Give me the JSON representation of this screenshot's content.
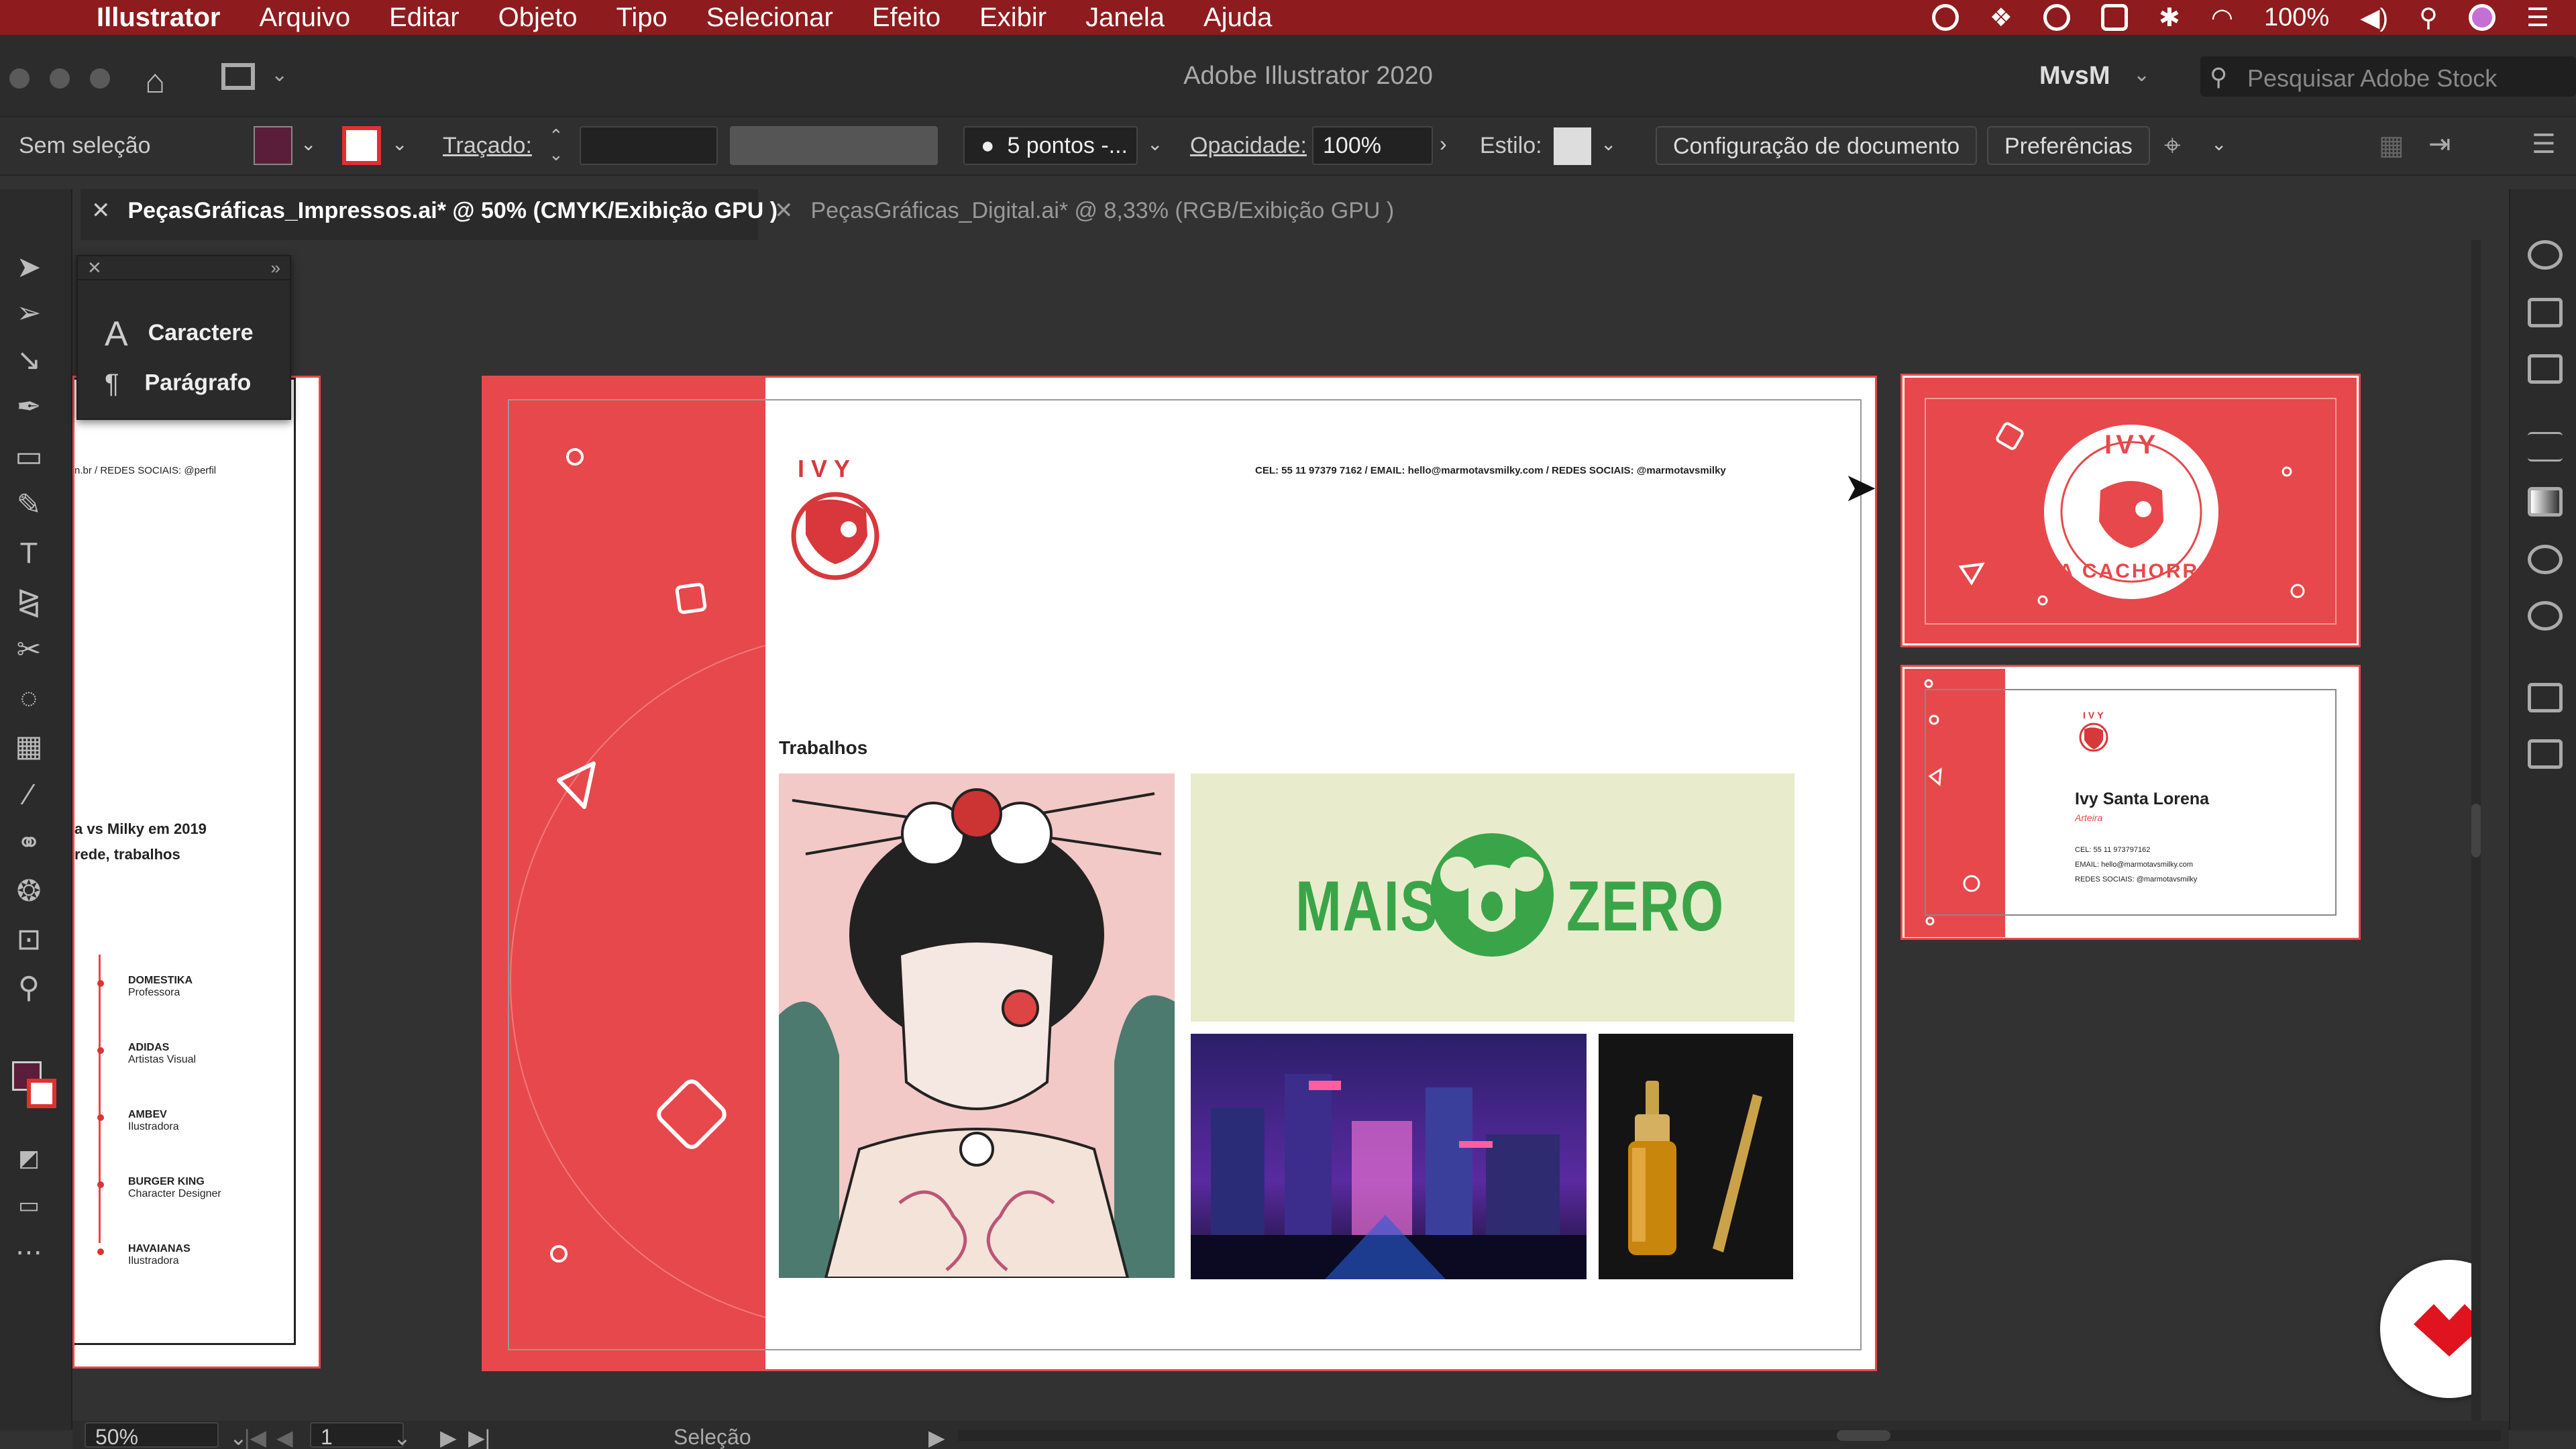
{
  "menubar": {
    "apple": "",
    "app_name": "Illustrator",
    "items": [
      "Arquivo",
      "Editar",
      "Objeto",
      "Tipo",
      "Selecionar",
      "Efeito",
      "Exibir",
      "Janela",
      "Ajuda"
    ],
    "battery": "100%"
  },
  "titlebar": {
    "title": "Adobe Illustrator 2020",
    "workspace": "MvsM",
    "search_placeholder": "Pesquisar Adobe Stock"
  },
  "control": {
    "selection": "Sem seleção",
    "stroke_label": "Traçado:",
    "brush": "5 pontos -...",
    "opacity_label": "Opacidade:",
    "opacity_value": "100%",
    "style_label": "Estilo:",
    "doc_setup": "Configuração de documento",
    "preferences": "Preferências",
    "fill_color": "#5a1e3a"
  },
  "tabs": [
    {
      "label": "PeçasGráficas_Impressos.ai* @ 50% (CMYK/Exibição GPU )",
      "active": true
    },
    {
      "label": "PeçasGráficas_Digital.ai* @ 8,33% (RGB/Exibição GPU )",
      "active": false
    }
  ],
  "char_panel": {
    "items": [
      "Caractere",
      "Parágrafo"
    ]
  },
  "cv_left": {
    "contact": "n.br / REDES SOCIAIS: @perfil",
    "line1": "a vs Milky em 2019",
    "line2": "rede, trabalhos",
    "items": [
      {
        "company": "DOMESTIKA",
        "role": "Professora"
      },
      {
        "company": "ADIDAS",
        "role": "Artistas Visual"
      },
      {
        "company": "AMBEV",
        "role": "Ilustradora"
      },
      {
        "company": "BURGER KING",
        "role": "Character Designer"
      },
      {
        "company": "HAVAIANAS",
        "role": "Ilustradora"
      }
    ]
  },
  "portfolio": {
    "logo_text": "IVY",
    "contact": "CEL: 55 11 97379 7162 / EMAIL: hello@marmotavsmilky.com / REDES SOCIAIS: @marmotavsmilky",
    "section": "Trabalhos",
    "brand_left": "MAIS",
    "brand_right": "ZERO"
  },
  "card_front": {
    "top": "IVY",
    "bottom": "A CACHORRA"
  },
  "card_back": {
    "name": "Ivy Santa Lorena",
    "role": "Arteira",
    "cel": "CEL: 55 11 973797162",
    "email": "EMAIL: hello@marmotavsmilky.com",
    "social": "REDES SOCIAIS: @marmotavsmilky"
  },
  "status": {
    "zoom": "50%",
    "page": "1",
    "mode": "Seleção"
  },
  "colors": {
    "menubar": "#8e1b1d",
    "accent_red": "#e7484b",
    "green": "#3aa548",
    "mint": "#e9eccc"
  }
}
